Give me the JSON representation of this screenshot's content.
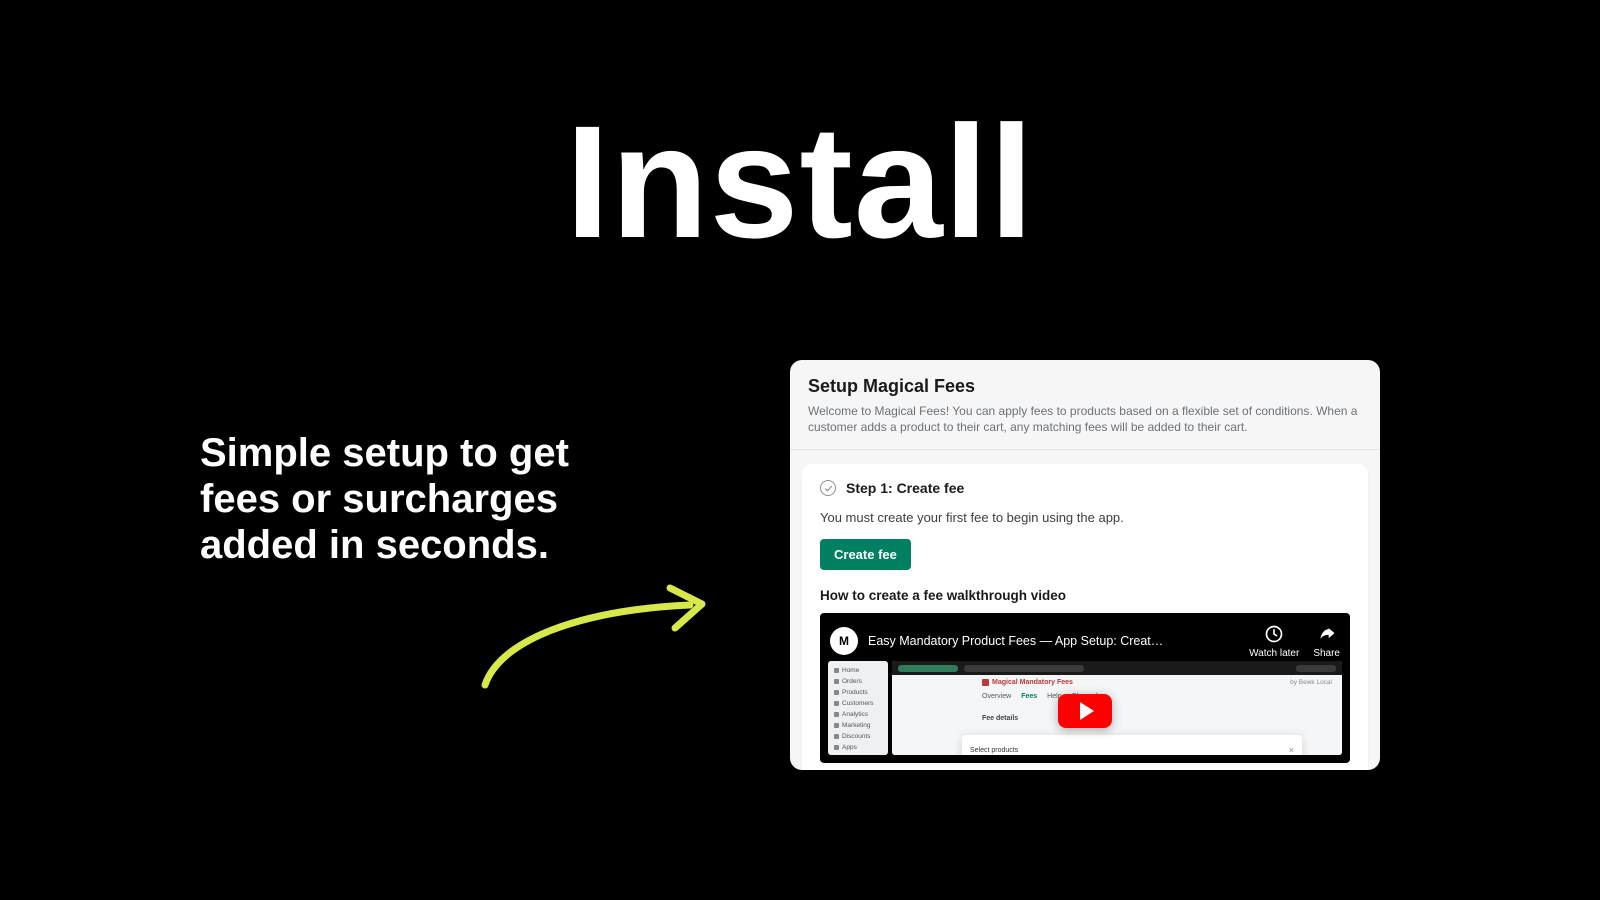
{
  "hero": {
    "headline": "Install",
    "tagline": "Simple setup to get fees or surcharges added in seconds."
  },
  "panel": {
    "title": "Setup Magical Fees",
    "description": "Welcome to Magical Fees! You can apply fees to products based on a flexible set of conditions. When a customer adds a product to their cart, any matching fees will be added to their cart.",
    "step": {
      "title": "Step 1: Create fee",
      "description": "You must create your first fee to begin using the app.",
      "cta": "Create fee"
    },
    "video": {
      "label": "How to create a fee walkthrough video",
      "title": "Easy Mandatory Product Fees — App Setup: Creat…",
      "avatar_initials": "M",
      "actions": {
        "watch_later": "Watch later",
        "share": "Share"
      },
      "app_title": "Magical Mandatory Fees",
      "by_line": "by Bewk Local",
      "tabs": [
        "Overview",
        "Fees",
        "Help",
        "Changelog"
      ],
      "section": "Fee details",
      "modal_title": "Select products",
      "sidebar_items": [
        "Home",
        "Orders",
        "Products",
        "Customers",
        "Analytics",
        "Marketing",
        "Discounts",
        "Apps"
      ]
    }
  }
}
